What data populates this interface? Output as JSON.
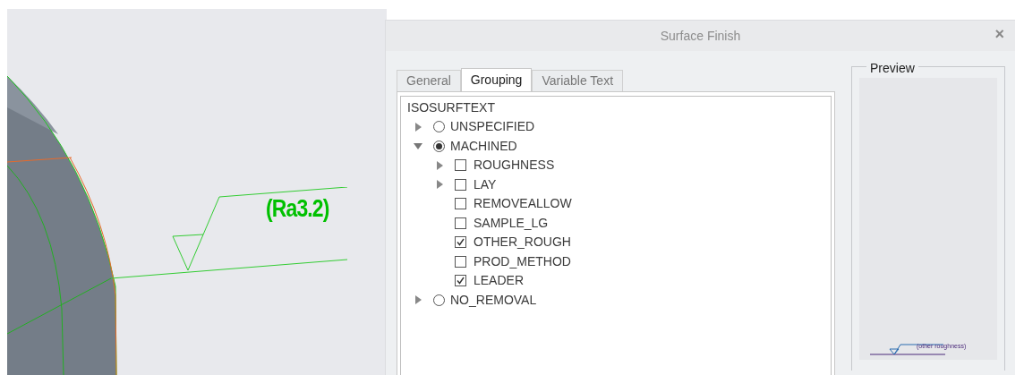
{
  "viewport": {
    "annotation": "(Ra3.2)"
  },
  "dialog": {
    "title": "Surface Finish",
    "close": "×",
    "tabs": [
      {
        "label": "General",
        "selected": false
      },
      {
        "label": "Grouping",
        "selected": true
      },
      {
        "label": "Variable Text",
        "selected": false
      }
    ],
    "tree": {
      "label": "ISOSURFTEXT",
      "children": [
        {
          "kind": "radio",
          "label": "UNSPECIFIED",
          "selected": false,
          "expanded": false
        },
        {
          "kind": "radio",
          "label": "MACHINED",
          "selected": true,
          "expanded": true,
          "children": [
            {
              "kind": "checkbox",
              "label": "ROUGHNESS",
              "checked": false,
              "expanded": false
            },
            {
              "kind": "checkbox",
              "label": "LAY",
              "checked": false,
              "expanded": false
            },
            {
              "kind": "checkbox",
              "label": "REMOVEALLOW",
              "checked": false
            },
            {
              "kind": "checkbox",
              "label": "SAMPLE_LG",
              "checked": false
            },
            {
              "kind": "checkbox",
              "label": "OTHER_ROUGH",
              "checked": true
            },
            {
              "kind": "checkbox",
              "label": "PROD_METHOD",
              "checked": false
            },
            {
              "kind": "checkbox",
              "label": "LEADER",
              "checked": true
            }
          ]
        },
        {
          "kind": "radio",
          "label": "NO_REMOVAL",
          "selected": false,
          "expanded": false
        }
      ]
    },
    "preview": {
      "title": "Preview",
      "symbol_text": "(other roughness)"
    }
  }
}
